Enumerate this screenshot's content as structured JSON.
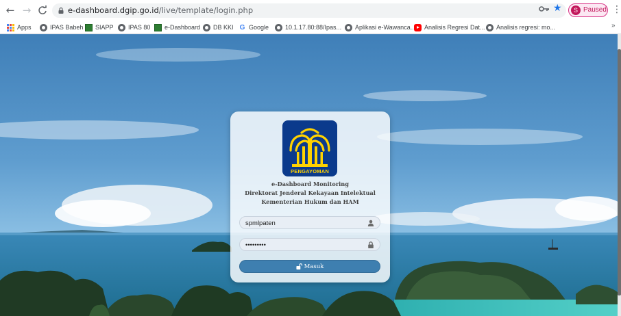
{
  "browser": {
    "url_host": "e-dashboard.dgip.go.id",
    "url_path": "/live/template/login.php",
    "profile_initial": "S",
    "profile_status": "Paused",
    "bookmarks": [
      {
        "label": "Apps",
        "icon": "apps-grid-icon"
      },
      {
        "label": "IPAS Babeh",
        "icon": "globe-icon"
      },
      {
        "label": "SIAPP",
        "icon": "site-icon"
      },
      {
        "label": "IPAS 80",
        "icon": "globe-icon"
      },
      {
        "label": "e-Dashboard",
        "icon": "site-icon"
      },
      {
        "label": "DB KKI",
        "icon": "globe-icon"
      },
      {
        "label": "Google",
        "icon": "google-icon"
      },
      {
        "label": "10.1.17.80:88/Ipas...",
        "icon": "globe-icon"
      },
      {
        "label": "Aplikasi e-Wawanca...",
        "icon": "globe-icon"
      },
      {
        "label": "Analisis Regresi Dat...",
        "icon": "youtube-icon"
      },
      {
        "label": "Analisis regresi: mo...",
        "icon": "globe-icon"
      }
    ],
    "more_label": "»"
  },
  "login": {
    "logo_text": "PENGAYOMAN",
    "title_line1": "e-Dashboard Monitoring",
    "title_line2": "Direktorat Jenderal Kekayaan Intelektual",
    "title_line3": "Kementerian Hukum dan HAM",
    "username_value": "spmlpaten",
    "password_value": "spmlpaten",
    "button_label": "Masuk"
  },
  "colors": {
    "accent": "#3e7fb0",
    "logo_bg": "#0b3a8c",
    "logo_gold": "#ffd200",
    "profile": "#c2185b"
  }
}
